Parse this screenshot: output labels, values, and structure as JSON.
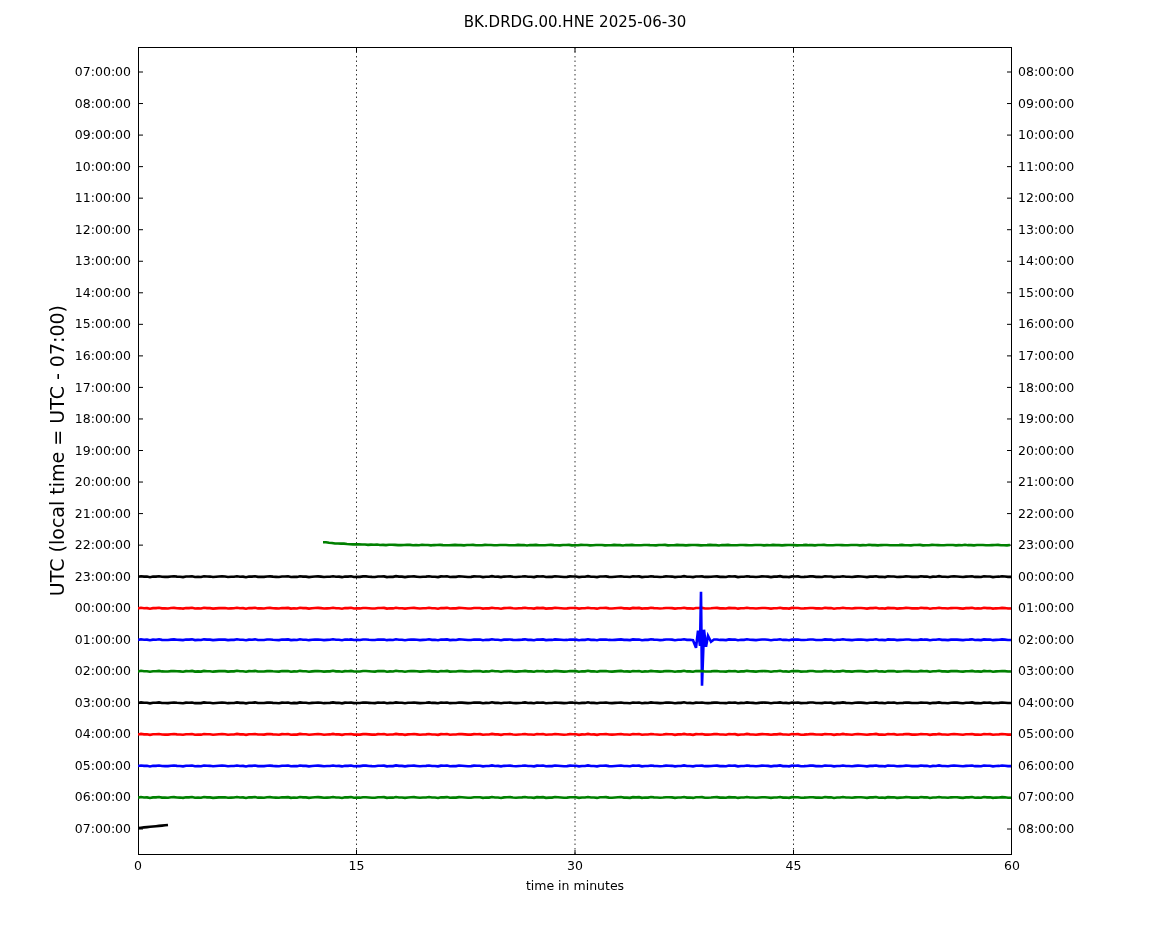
{
  "title": "BK.DRDG.00.HNE 2025-06-30",
  "ylabel": "UTC (local time = UTC - 07:00)",
  "xlabel": "time in minutes",
  "xticks": [
    "0",
    "15",
    "30",
    "45",
    "60"
  ],
  "rows": [
    {
      "left": "07:00:00",
      "right": "08:00:00"
    },
    {
      "left": "08:00:00",
      "right": "09:00:00"
    },
    {
      "left": "09:00:00",
      "right": "10:00:00"
    },
    {
      "left": "10:00:00",
      "right": "11:00:00"
    },
    {
      "left": "11:00:00",
      "right": "12:00:00"
    },
    {
      "left": "12:00:00",
      "right": "13:00:00"
    },
    {
      "left": "13:00:00",
      "right": "14:00:00"
    },
    {
      "left": "14:00:00",
      "right": "15:00:00"
    },
    {
      "left": "15:00:00",
      "right": "16:00:00"
    },
    {
      "left": "16:00:00",
      "right": "17:00:00"
    },
    {
      "left": "17:00:00",
      "right": "18:00:00"
    },
    {
      "left": "18:00:00",
      "right": "19:00:00"
    },
    {
      "left": "19:00:00",
      "right": "20:00:00"
    },
    {
      "left": "20:00:00",
      "right": "21:00:00"
    },
    {
      "left": "21:00:00",
      "right": "22:00:00"
    },
    {
      "left": "22:00:00",
      "right": "23:00:00",
      "trace": {
        "kind": "late-start",
        "color": "#008000"
      }
    },
    {
      "left": "23:00:00",
      "right": "00:00:00",
      "trace": {
        "kind": "full",
        "color": "#000000"
      }
    },
    {
      "left": "00:00:00",
      "right": "01:00:00",
      "trace": {
        "kind": "full",
        "color": "#ff0000"
      }
    },
    {
      "left": "01:00:00",
      "right": "02:00:00",
      "trace": {
        "kind": "event",
        "color": "#0000ff"
      }
    },
    {
      "left": "02:00:00",
      "right": "03:00:00",
      "trace": {
        "kind": "full",
        "color": "#008000"
      }
    },
    {
      "left": "03:00:00",
      "right": "04:00:00",
      "trace": {
        "kind": "full",
        "color": "#000000"
      }
    },
    {
      "left": "04:00:00",
      "right": "05:00:00",
      "trace": {
        "kind": "full",
        "color": "#ff0000"
      }
    },
    {
      "left": "05:00:00",
      "right": "06:00:00",
      "trace": {
        "kind": "full",
        "color": "#0000ff"
      }
    },
    {
      "left": "06:00:00",
      "right": "07:00:00",
      "trace": {
        "kind": "full",
        "color": "#008000"
      }
    },
    {
      "left": "07:00:00",
      "right": "08:00:00",
      "trace": {
        "kind": "early-end",
        "color": "#000000"
      }
    }
  ]
}
